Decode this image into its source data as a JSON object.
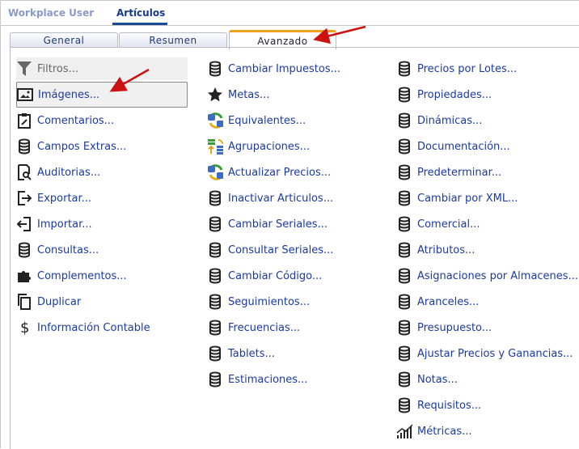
{
  "top_tabs": [
    "Workplace User",
    "Artículos"
  ],
  "sub_tabs": [
    "General",
    "Resumen",
    "Avanzado"
  ],
  "col1": [
    {
      "label": "Filtros...",
      "icon": "filter-icon"
    },
    {
      "label": "Imágenes...",
      "icon": "image-icon"
    },
    {
      "label": "Comentarios...",
      "icon": "clipboard-edit-icon"
    },
    {
      "label": "Campos Extras...",
      "icon": "database-icon"
    },
    {
      "label": "Auditorias...",
      "icon": "document-search-icon"
    },
    {
      "label": "Exportar...",
      "icon": "export-icon"
    },
    {
      "label": "Importar...",
      "icon": "import-icon"
    },
    {
      "label": "Consultas...",
      "icon": "database-icon"
    },
    {
      "label": "Complementos...",
      "icon": "puzzle-icon"
    },
    {
      "label": "Duplicar",
      "icon": "copy-icon"
    },
    {
      "label": "Información Contable",
      "icon": "dollar-icon"
    }
  ],
  "col2": [
    {
      "label": "Cambiar Impuestos...",
      "icon": "database-icon"
    },
    {
      "label": "Metas...",
      "icon": "star-icon"
    },
    {
      "label": "Equivalentes...",
      "icon": "sync-icon"
    },
    {
      "label": "Agrupaciones...",
      "icon": "grouping-icon"
    },
    {
      "label": "Actualizar Precios...",
      "icon": "sync-icon"
    },
    {
      "label": "Inactivar Articulos...",
      "icon": "database-icon"
    },
    {
      "label": "Cambiar Seriales...",
      "icon": "database-icon"
    },
    {
      "label": "Consultar Seriales...",
      "icon": "database-icon"
    },
    {
      "label": "Cambiar Código...",
      "icon": "database-icon"
    },
    {
      "label": "Seguimientos...",
      "icon": "database-icon"
    },
    {
      "label": "Frecuencias...",
      "icon": "database-icon"
    },
    {
      "label": "Tablets...",
      "icon": "database-icon"
    },
    {
      "label": "Estimaciones...",
      "icon": "database-icon"
    }
  ],
  "col3": [
    {
      "label": "Precios por Lotes...",
      "icon": "database-icon"
    },
    {
      "label": "Propiedades...",
      "icon": "database-icon"
    },
    {
      "label": "Dinámicas...",
      "icon": "database-icon"
    },
    {
      "label": "Documentación...",
      "icon": "database-icon"
    },
    {
      "label": "Predeterminar...",
      "icon": "database-icon"
    },
    {
      "label": "Cambiar por XML...",
      "icon": "database-icon"
    },
    {
      "label": "Comercial...",
      "icon": "database-icon"
    },
    {
      "label": "Atributos...",
      "icon": "database-icon"
    },
    {
      "label": "Asignaciones por Almacenes...",
      "icon": "database-icon"
    },
    {
      "label": "Aranceles...",
      "icon": "database-icon"
    },
    {
      "label": "Presupuesto...",
      "icon": "database-icon"
    },
    {
      "label": "Ajustar Precios y Ganancias...",
      "icon": "database-icon"
    },
    {
      "label": "Notas...",
      "icon": "database-icon"
    },
    {
      "label": "Requisitos...",
      "icon": "database-icon"
    },
    {
      "label": "Métricas...",
      "icon": "chart-icon"
    }
  ]
}
